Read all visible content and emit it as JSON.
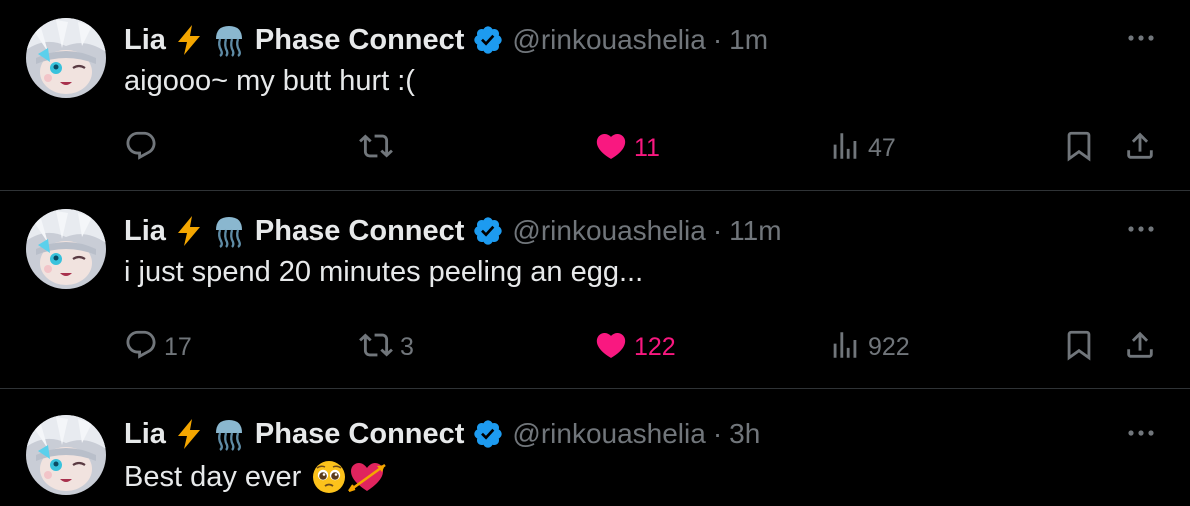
{
  "colors": {
    "background": "#000000",
    "text": "#e7e9ea",
    "muted": "#71767b",
    "like": "#f91880",
    "verified": "#1d9bf0",
    "divider": "#2f3336"
  },
  "tweets": [
    {
      "author": {
        "name": "Lia",
        "emoji_1": "⚡",
        "emoji_2": "🪼",
        "affiliation": "Phase Connect",
        "handle": "@rinkouashelia",
        "verified_icon": "verified-badge-icon",
        "avatar_icon": "avatar"
      },
      "separator": "·",
      "time": "1m",
      "text": "aigooo~ my butt hurt :(",
      "actions": {
        "replies": "",
        "reposts": "",
        "likes": "11",
        "views": "47",
        "liked": true
      }
    },
    {
      "author": {
        "name": "Lia",
        "emoji_1": "⚡",
        "emoji_2": "🪼",
        "affiliation": "Phase Connect",
        "handle": "@rinkouashelia",
        "verified_icon": "verified-badge-icon",
        "avatar_icon": "avatar"
      },
      "separator": "·",
      "time": "11m",
      "text": "i just spend 20 minutes peeling an egg...",
      "actions": {
        "replies": "17",
        "reposts": "3",
        "likes": "122",
        "views": "922",
        "liked": true
      }
    },
    {
      "author": {
        "name": "Lia",
        "emoji_1": "⚡",
        "emoji_2": "🪼",
        "affiliation": "Phase Connect",
        "handle": "@rinkouashelia",
        "verified_icon": "verified-badge-icon",
        "avatar_icon": "avatar"
      },
      "separator": "·",
      "time": "3h",
      "text": "Best day ever",
      "text_emojis": [
        "pleading-face-icon",
        "heart-with-arrow-icon"
      ]
    }
  ]
}
